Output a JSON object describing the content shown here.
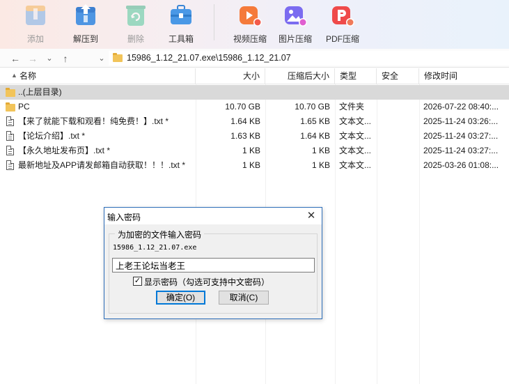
{
  "toolbar": {
    "items": [
      {
        "label": "添加",
        "icon": "add-archive-icon",
        "disabled": true
      },
      {
        "label": "解压到",
        "icon": "extract-to-icon",
        "disabled": false
      },
      {
        "label": "删除",
        "icon": "delete-recycle-icon",
        "disabled": true
      },
      {
        "label": "工具箱",
        "icon": "toolbox-icon",
        "disabled": false
      },
      {
        "label": "视频压缩",
        "icon": "video-compress-icon",
        "disabled": false
      },
      {
        "label": "图片压缩",
        "icon": "image-compress-icon",
        "disabled": false
      },
      {
        "label": "PDF压缩",
        "icon": "pdf-compress-icon",
        "disabled": false
      }
    ]
  },
  "address": {
    "path": "15986_1.12_21.07.exe\\15986_1.12_21.07"
  },
  "columns": {
    "name": "名称",
    "size": "大小",
    "packed": "压缩后大小",
    "type": "类型",
    "security": "安全",
    "modified": "修改时间"
  },
  "rows": [
    {
      "name": "..(上层目录)",
      "size": "",
      "packed": "",
      "type": "",
      "security": "",
      "modified": "",
      "kind": "parent"
    },
    {
      "name": "PC",
      "size": "10.70 GB",
      "packed": "10.70 GB",
      "type": "文件夹",
      "security": "",
      "modified": "2026-07-22 08:40:...",
      "kind": "folder"
    },
    {
      "name": "【来了就能下载和观看！纯免费！】.txt *",
      "size": "1.64 KB",
      "packed": "1.65 KB",
      "type": "文本文...",
      "security": "",
      "modified": "2025-11-24 03:26:...",
      "kind": "file"
    },
    {
      "name": "【论坛介绍】.txt *",
      "size": "1.63 KB",
      "packed": "1.64 KB",
      "type": "文本文...",
      "security": "",
      "modified": "2025-11-24 03:27:...",
      "kind": "file"
    },
    {
      "name": "【永久地址发布页】.txt *",
      "size": "1 KB",
      "packed": "1 KB",
      "type": "文本文...",
      "security": "",
      "modified": "2025-11-24 03:27:...",
      "kind": "file"
    },
    {
      "name": "最新地址及APP请发邮箱自动获取！！！.txt *",
      "size": "1 KB",
      "packed": "1 KB",
      "type": "文本文...",
      "security": "",
      "modified": "2025-03-26 01:08:...",
      "kind": "file"
    }
  ],
  "dialog": {
    "title": "输入密码",
    "group_label": "为加密的文件输入密码",
    "filename": "15986_1.12_21.07.exe",
    "password_value": "上老王论坛当老王",
    "show_password_label": "显示密码（勾选可支持中文密码）",
    "show_password_checked": true,
    "ok_label": "确定(O)",
    "cancel_label": "取消(C)"
  }
}
